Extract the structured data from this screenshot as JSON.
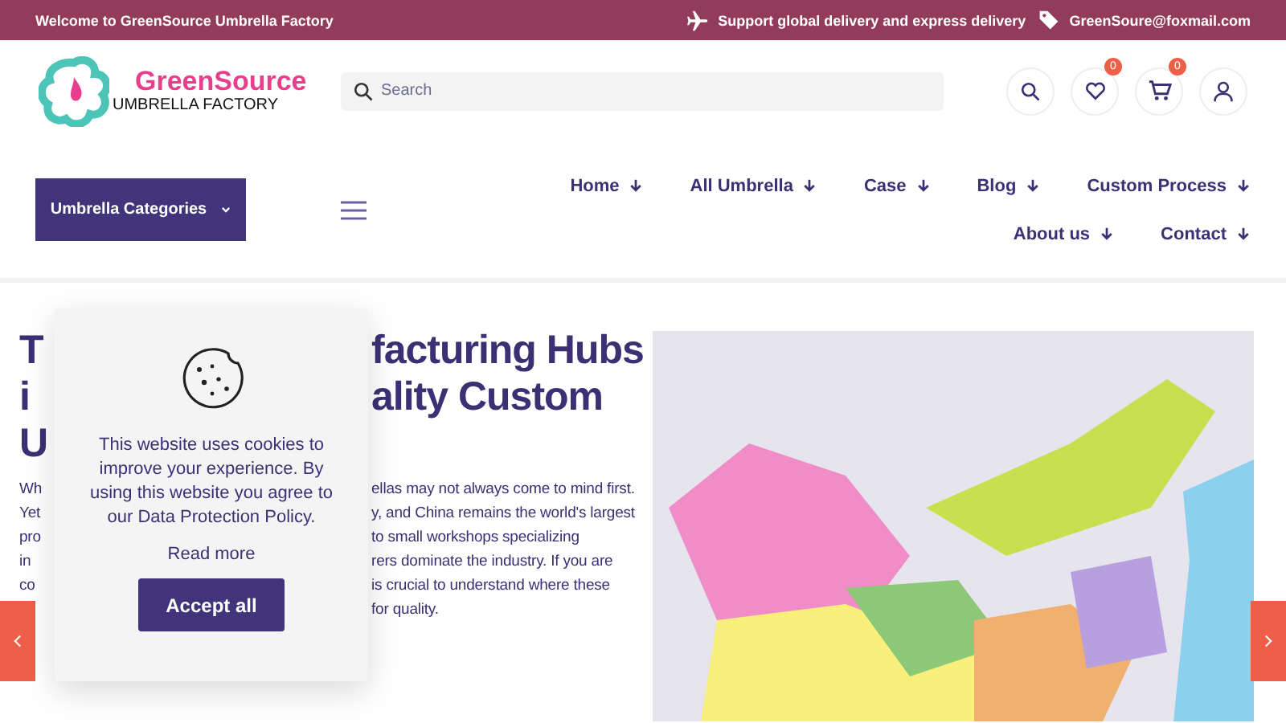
{
  "top_bar": {
    "welcome": "Welcome to GreenSource Umbrella Factory",
    "delivery": "Support global delivery and express delivery",
    "email": "GreenSoure@foxmail.com"
  },
  "header": {
    "logo_name": "GreenSource",
    "logo_tagline": "UMBRELLA FACTORY",
    "search": {
      "placeholder": "Search"
    },
    "wishlist_count": "0",
    "cart_count": "0"
  },
  "nav": {
    "categories_button": "Umbrella Categories",
    "items": [
      {
        "label": "Home"
      },
      {
        "label": "All Umbrella"
      },
      {
        "label": "Case"
      },
      {
        "label": "Blog"
      },
      {
        "label": "Custom Process"
      },
      {
        "label": "About us"
      },
      {
        "label": "Contact"
      }
    ]
  },
  "article": {
    "heading_lines": [
      {
        "left": "T",
        "right": "facturing Hubs"
      },
      {
        "left": "i",
        "right": "ality Custom"
      },
      {
        "left": "U"
      }
    ],
    "paragraph_lines": [
      {
        "left": "Wh",
        "right": "ellas may not always come to mind first."
      },
      {
        "left": "Yet",
        "right": "y, and China remains the world's largest"
      },
      {
        "left": "pro",
        "right": "to small workshops specializing"
      },
      {
        "left": "in",
        "right": "rers dominate the industry. If you are"
      },
      {
        "left": "co",
        "right": "is crucial to understand where these"
      },
      {
        "right": "for quality."
      }
    ]
  },
  "cookie_popup": {
    "message": "This website uses cookies to improve your experience. By using this website you agree to our Data Protection Policy.",
    "read_more": "Read more",
    "accept": "Accept all"
  }
}
